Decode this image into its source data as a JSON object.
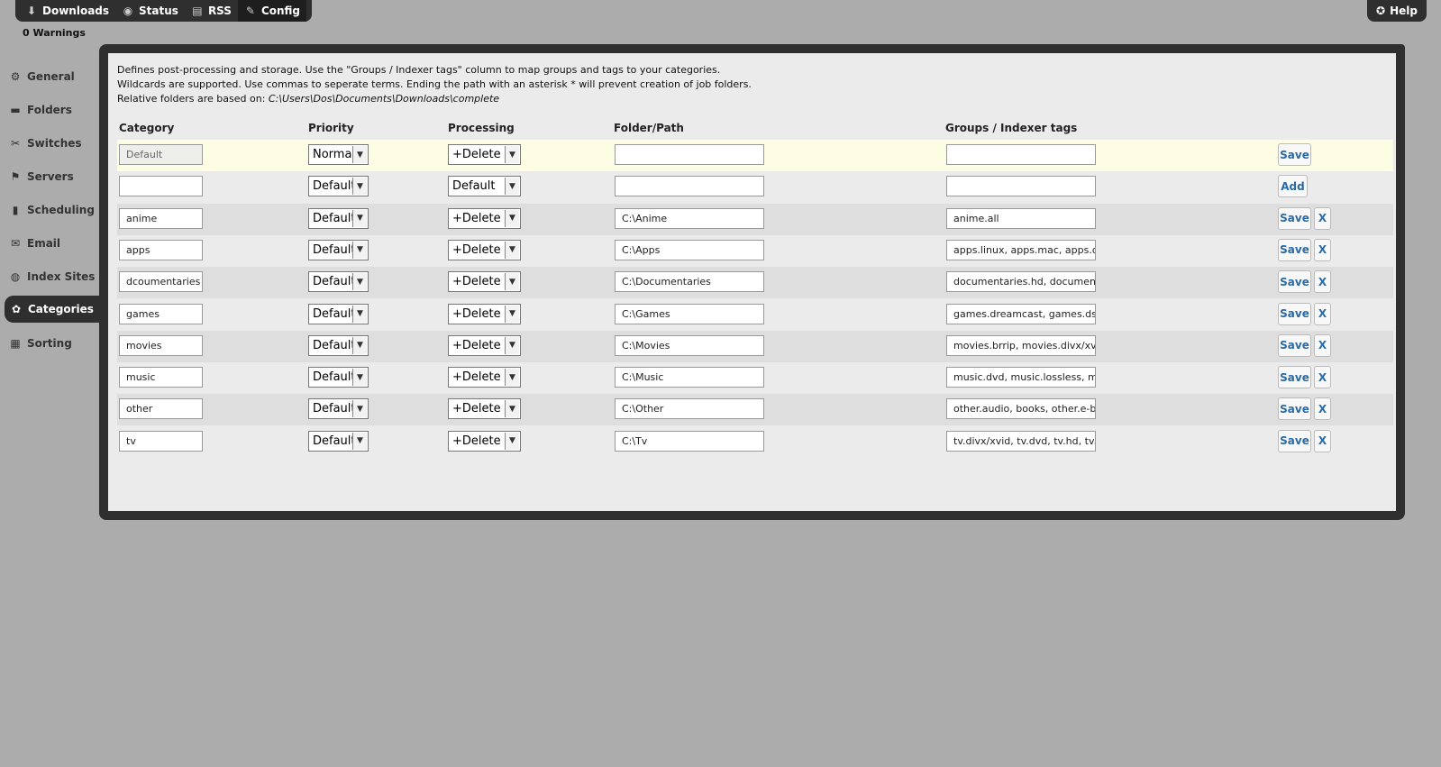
{
  "topnav": {
    "items": [
      {
        "label": "Downloads",
        "icon": "downloads-icon",
        "glyph": "⬇"
      },
      {
        "label": "Status",
        "icon": "status-icon",
        "glyph": "◉"
      },
      {
        "label": "RSS",
        "icon": "rss-icon",
        "glyph": "▤"
      },
      {
        "label": "Config",
        "icon": "wrench-icon",
        "glyph": "✎"
      }
    ],
    "active": 3
  },
  "help": {
    "label": "Help",
    "glyph": "✪"
  },
  "warnings": "0 Warnings",
  "sidebar": {
    "items": [
      {
        "label": "General",
        "icon": "gear-icon",
        "glyph": "⚙"
      },
      {
        "label": "Folders",
        "icon": "folder-icon",
        "glyph": "▬"
      },
      {
        "label": "Switches",
        "icon": "switches-icon",
        "glyph": "✂"
      },
      {
        "label": "Servers",
        "icon": "servers-icon",
        "glyph": "⚑"
      },
      {
        "label": "Scheduling",
        "icon": "scheduling-icon",
        "glyph": "▮"
      },
      {
        "label": "Email",
        "icon": "email-icon",
        "glyph": "✉"
      },
      {
        "label": "Index Sites",
        "icon": "index-sites-icon",
        "glyph": "◍"
      },
      {
        "label": "Categories",
        "icon": "categories-icon",
        "glyph": "✿"
      },
      {
        "label": "Sorting",
        "icon": "sorting-icon",
        "glyph": "▦"
      }
    ],
    "active": 7
  },
  "description": {
    "line1": "Defines post-processing and storage. Use the \"Groups / Indexer tags\" column to map groups and tags to your categories.",
    "line2": "Wildcards are supported. Use commas to seperate terms. Ending the path with an asterisk * will prevent creation of job folders.",
    "line3_prefix": "Relative folders are based on: ",
    "line3_path": "C:\\Users\\Dos\\Documents\\Downloads\\complete"
  },
  "table": {
    "headers": {
      "category": "Category",
      "priority": "Priority",
      "processing": "Processing",
      "folder": "Folder/Path",
      "groups": "Groups / Indexer tags"
    },
    "rows": [
      {
        "category": "Default",
        "priority": "Normal",
        "processing": "+Delete",
        "folder": "",
        "groups": "",
        "action": "Save",
        "delete": ""
      },
      {
        "category": "",
        "priority": "Default",
        "processing": "Default",
        "folder": "",
        "groups": "",
        "action": "Add",
        "delete": ""
      },
      {
        "category": "anime",
        "priority": "Default",
        "processing": "+Delete",
        "folder": "C:\\Anime",
        "groups": "anime.all",
        "action": "Save",
        "delete": "X"
      },
      {
        "category": "apps",
        "priority": "Default",
        "processing": "+Delete",
        "folder": "C:\\Apps",
        "groups": "apps.linux, apps.mac, apps.othe",
        "action": "Save",
        "delete": "X"
      },
      {
        "category": "dcoumentaries",
        "priority": "Default",
        "processing": "+Delete",
        "folder": "C:\\Documentaries",
        "groups": "documentaries.hd, documentari",
        "action": "Save",
        "delete": "X"
      },
      {
        "category": "games",
        "priority": "Default",
        "processing": "+Delete",
        "folder": "C:\\Games",
        "groups": "games.dreamcast, games.ds, ga",
        "action": "Save",
        "delete": "X"
      },
      {
        "category": "movies",
        "priority": "Default",
        "processing": "+Delete",
        "folder": "C:\\Movies",
        "groups": "movies.brrip, movies.divx/xvid,",
        "action": "Save",
        "delete": "X"
      },
      {
        "category": "music",
        "priority": "Default",
        "processing": "+Delete",
        "folder": "C:\\Music",
        "groups": "music.dvd, music.lossless, music",
        "action": "Save",
        "delete": "X"
      },
      {
        "category": "other",
        "priority": "Default",
        "processing": "+Delete",
        "folder": "C:\\Other",
        "groups": "other.audio, books, other.e-boo",
        "action": "Save",
        "delete": "X"
      },
      {
        "category": "tv",
        "priority": "Default",
        "processing": "+Delete",
        "folder": "C:\\Tv",
        "groups": "tv.divx/xvid, tv.dvd, tv.hd, tv.",
        "action": "Save",
        "delete": "X"
      }
    ]
  },
  "colors": {
    "background": "#acacac",
    "panel": "#2f2f2f",
    "inner": "#ebebeb",
    "highlight_row": "#fdfde4",
    "link": "#2a6aa5"
  }
}
